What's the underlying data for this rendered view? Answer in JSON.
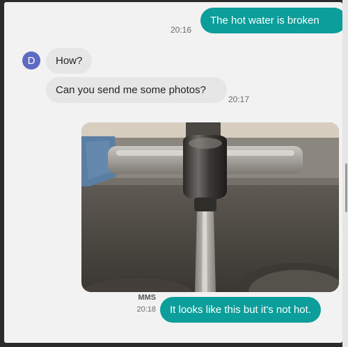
{
  "messages": [
    {
      "direction": "outgoing",
      "text": "The hot water is broken",
      "time": "20:16"
    },
    {
      "direction": "incoming",
      "text": "How?"
    },
    {
      "direction": "incoming",
      "text": "Can you send me some photos?",
      "time": "20:17"
    },
    {
      "direction": "outgoing",
      "type": "mms",
      "label": "MMS",
      "time": "20:18",
      "text": "It looks like this but it's not hot."
    }
  ],
  "contact": {
    "avatar_initial": "D",
    "avatar_color": "#5d6bc2"
  },
  "photo": {
    "subject": "sink faucet with running water"
  },
  "colors": {
    "outgoing_bubble": "#0b9e9a",
    "incoming_bubble": "#e6e6e6",
    "background": "#f2f2f2"
  }
}
